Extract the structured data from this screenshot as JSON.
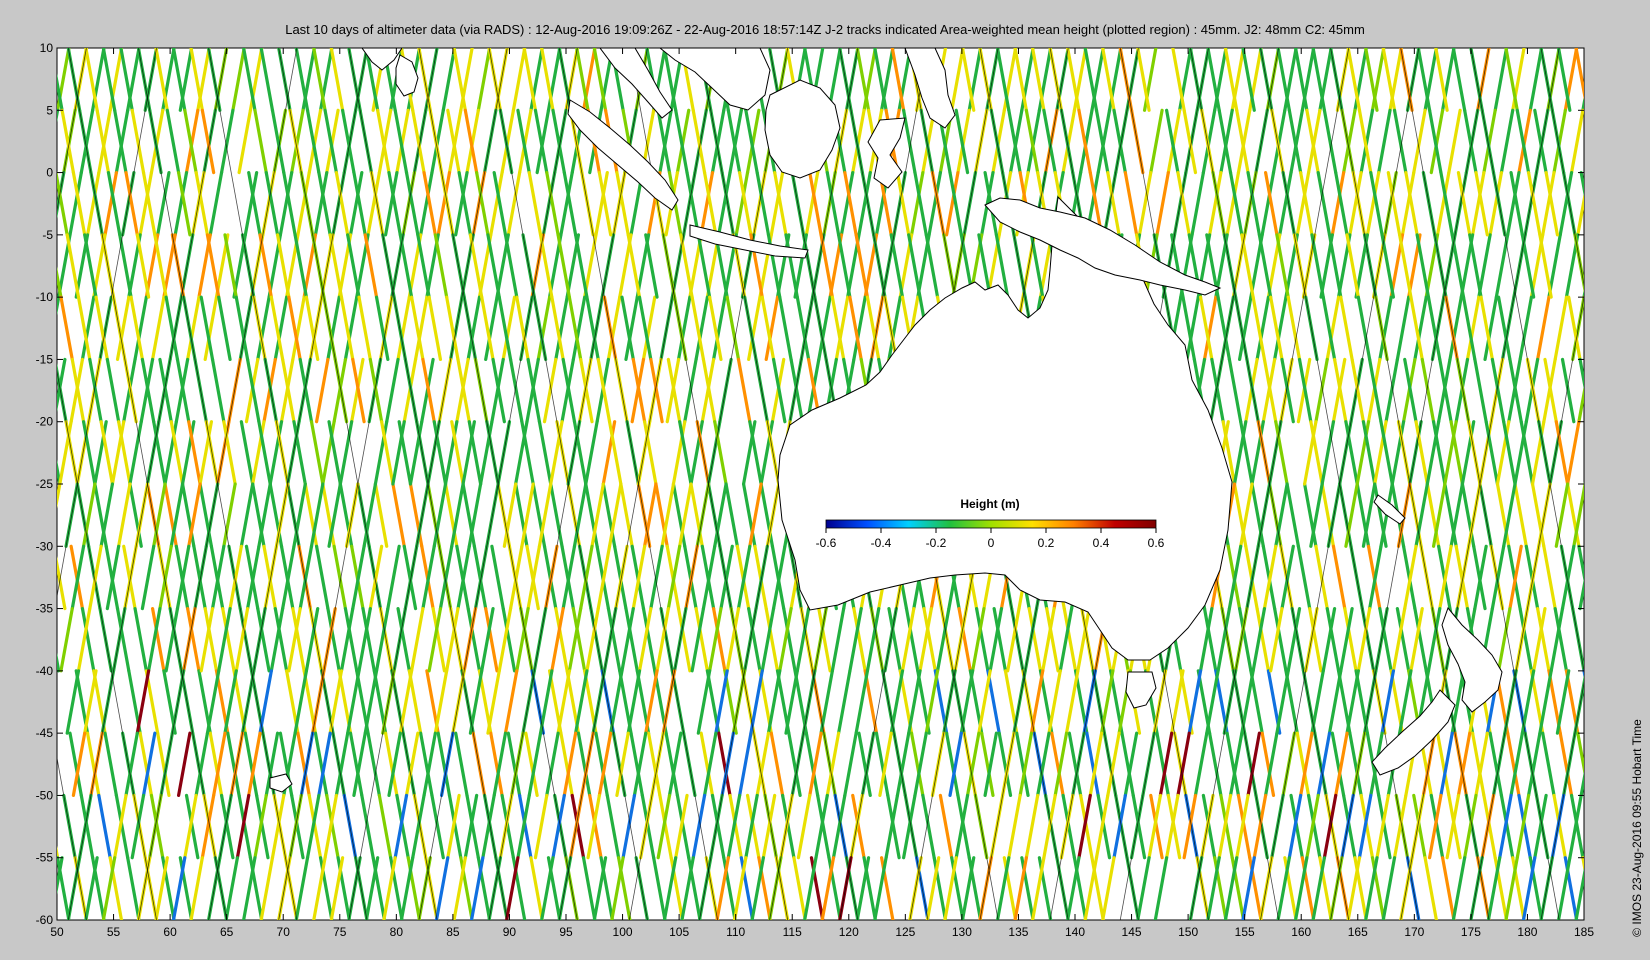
{
  "title": "Last 10 days of altimeter data (via RADS) : 12-Aug-2016 19:09:26Z - 22-Aug-2016 18:57:14Z  J-2 tracks indicated  Area-weighted mean height (plotted region) : 45mm.  J2: 48mm  C2: 45mm",
  "side_label": "© IMOS 23-Aug-2016 09:55 Hobart Time",
  "axes": {
    "x_range": [
      50,
      185
    ],
    "y_range": [
      -60,
      10
    ],
    "x_ticks": [
      "50",
      "55",
      "60",
      "65",
      "70",
      "75",
      "80",
      "85",
      "90",
      "95",
      "100",
      "105",
      "110",
      "115",
      "120",
      "125",
      "130",
      "135",
      "140",
      "145",
      "150",
      "155",
      "160",
      "165",
      "170",
      "175",
      "180",
      "185"
    ],
    "y_ticks": [
      "10",
      "5",
      "0",
      "-5",
      "-10",
      "-15",
      "-20",
      "-25",
      "-30",
      "-35",
      "-40",
      "-45",
      "-50",
      "-55",
      "-60"
    ]
  },
  "colorbar": {
    "title": "Height (m)",
    "ticks": [
      "-0.6",
      "-0.4",
      "-0.2",
      "0",
      "0.2",
      "0.4",
      "0.6"
    ],
    "range": [
      -0.6,
      0.6
    ],
    "colors": [
      "#00008f",
      "#0050ff",
      "#00d0ff",
      "#20c040",
      "#a0e000",
      "#ffe000",
      "#ff8000",
      "#c00000",
      "#800000"
    ]
  },
  "colors": {
    "background": "#c8c8c8",
    "plot_bg": "#ffffff",
    "land": "#ffffff",
    "coast": "#000000",
    "track_line": "#000000",
    "data_green": "#22b040",
    "data_yellow": "#e8e000",
    "data_orange": "#ff9000",
    "data_blue": "#1070e0",
    "data_darkred": "#8a0010"
  }
}
